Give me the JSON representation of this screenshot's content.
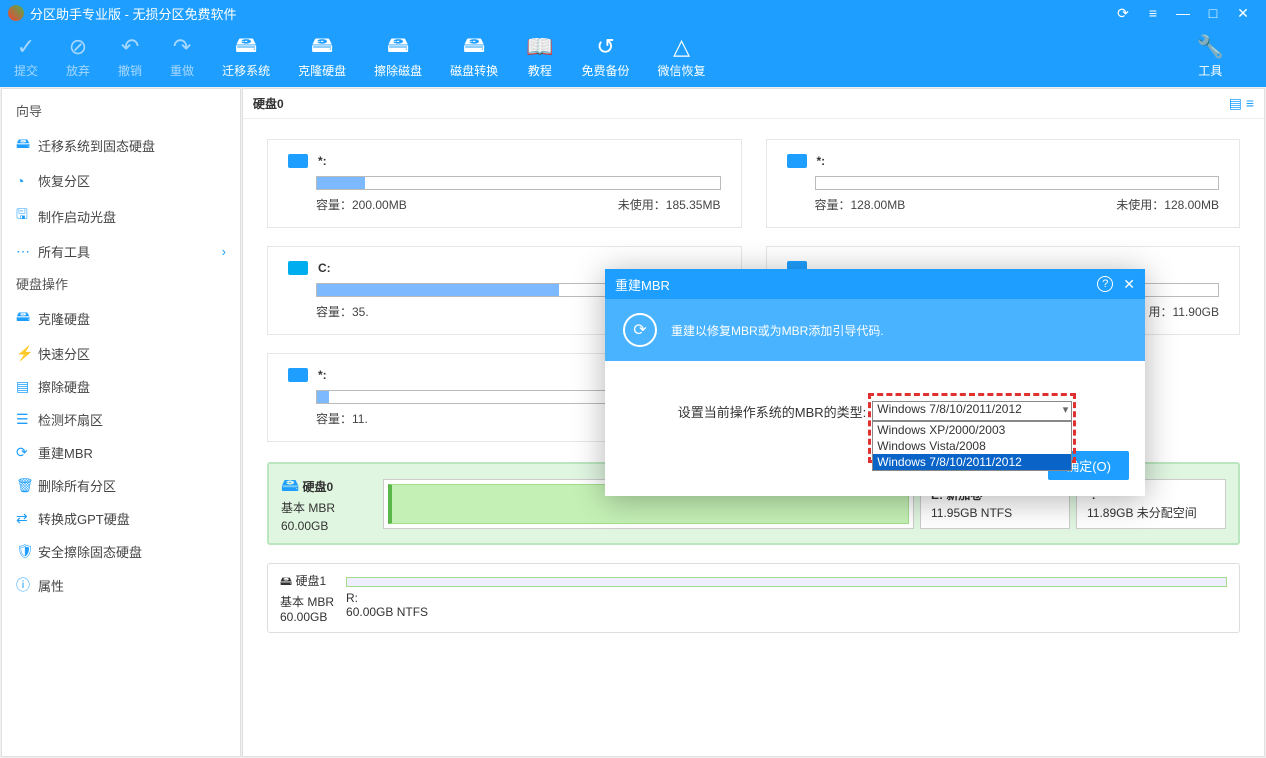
{
  "title": "分区助手专业版 - 无损分区免费软件",
  "winbtns": {
    "refresh": "⟳",
    "menu": "≡",
    "min": "—",
    "max": "□",
    "close": "✕"
  },
  "toolbar": [
    {
      "id": "commit",
      "label": "提交",
      "icon": "✓",
      "dim": true
    },
    {
      "id": "discard",
      "label": "放弃",
      "icon": "⊘",
      "dim": true
    },
    {
      "id": "undo",
      "label": "撤销",
      "icon": "↶",
      "dim": true
    },
    {
      "id": "redo",
      "label": "重做",
      "icon": "↷",
      "dim": true
    },
    {
      "id": "migrate",
      "label": "迁移系统",
      "icon": "🖴",
      "dim": false
    },
    {
      "id": "clone",
      "label": "克隆硬盘",
      "icon": "🖴",
      "dim": false
    },
    {
      "id": "wipe",
      "label": "擦除磁盘",
      "icon": "🖴",
      "dim": false
    },
    {
      "id": "convert",
      "label": "磁盘转换",
      "icon": "🖴",
      "dim": false
    },
    {
      "id": "tutorial",
      "label": "教程",
      "icon": "📖",
      "dim": false
    },
    {
      "id": "backup",
      "label": "免费备份",
      "icon": "↺",
      "dim": false
    },
    {
      "id": "wechat",
      "label": "微信恢复",
      "icon": "△",
      "dim": false
    }
  ],
  "toolbar_right": {
    "label": "工具",
    "icon": "🔧"
  },
  "sidebar": {
    "wizard_header": "向导",
    "wizard": [
      {
        "id": "migrate-ssd",
        "icon": "🖴",
        "label": "迁移系统到固态硬盘"
      },
      {
        "id": "recover",
        "icon": "◔",
        "label": "恢复分区"
      },
      {
        "id": "boot-disc",
        "icon": "🖫",
        "label": "制作启动光盘"
      },
      {
        "id": "all-tools",
        "icon": "⋯",
        "label": "所有工具",
        "arrow": "›"
      }
    ],
    "disk_header": "硬盘操作",
    "disk": [
      {
        "id": "clone-disk",
        "icon": "🖴",
        "label": "克隆硬盘"
      },
      {
        "id": "quick-part",
        "icon": "⚡",
        "label": "快速分区"
      },
      {
        "id": "wipe-disk",
        "icon": "▤",
        "label": "擦除硬盘"
      },
      {
        "id": "badsector",
        "icon": "☰",
        "label": "检测坏扇区"
      },
      {
        "id": "rebuild-mbr",
        "icon": "⟳",
        "label": "重建MBR"
      },
      {
        "id": "delete-all",
        "icon": "🗑",
        "label": "删除所有分区"
      },
      {
        "id": "to-gpt",
        "icon": "⇄",
        "label": "转换成GPT硬盘"
      },
      {
        "id": "secure-erase",
        "icon": "🛡",
        "label": "安全擦除固态硬盘"
      },
      {
        "id": "props",
        "icon": "ⓘ",
        "label": "属性"
      }
    ]
  },
  "content_title": "硬盘0",
  "cards": [
    {
      "letter": "*:",
      "capacity_lbl": "容量：",
      "capacity": "200.00MB",
      "unused_lbl": "未使用：",
      "unused": "185.35MB",
      "fill": 12
    },
    {
      "letter": "*:",
      "capacity_lbl": "容量：",
      "capacity": "128.00MB",
      "unused_lbl": "未使用：",
      "unused": "128.00MB",
      "fill": 0
    },
    {
      "letter": "C:",
      "capacity_lbl": "容量：",
      "capacity": "35.",
      "unused_lbl": "",
      "unused": "",
      "fill": 60,
      "win": true
    },
    {
      "letter": "",
      "capacity_lbl": "",
      "capacity": "",
      "unused_lbl": "用：",
      "unused": "11.90GB",
      "fill": 0
    },
    {
      "letter": "*:",
      "capacity_lbl": "容量：",
      "capacity": "11.",
      "unused_lbl": "",
      "unused": "",
      "fill": 3
    }
  ],
  "disks": [
    {
      "name": "硬盘0",
      "type": "基本 MBR",
      "size": "60.00GB",
      "selected": true,
      "parts": [
        {
          "name": "E: 新加卷",
          "info": "11.95GB NTFS"
        },
        {
          "name": "*:",
          "info": "11.89GB 未分配空间"
        }
      ]
    },
    {
      "name": "硬盘1",
      "type": "基本 MBR",
      "size": "60.00GB",
      "selected": false,
      "parts": [
        {
          "name": "R:",
          "info": "60.00GB NTFS"
        }
      ]
    }
  ],
  "modal": {
    "title": "重建MBR",
    "subtitle": "重建以修复MBR或为MBR添加引导代码.",
    "label": "设置当前操作系统的MBR的类型:",
    "selected": "Windows 7/8/10/2011/2012",
    "options": [
      "Windows XP/2000/2003",
      "Windows Vista/2008",
      "Windows 7/8/10/2011/2012"
    ],
    "ok": "确定(O)",
    "help": "?",
    "close": "✕"
  }
}
